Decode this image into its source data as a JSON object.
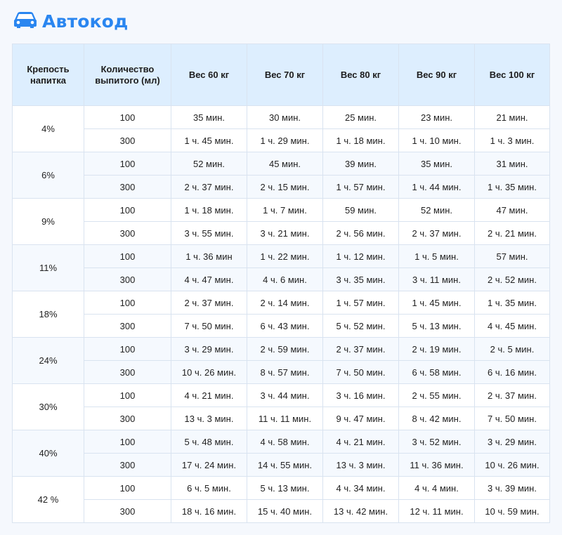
{
  "brand": {
    "name": "Автокод",
    "icon": "car-icon",
    "color": "#2a86f0"
  },
  "table": {
    "headers": [
      "Крепость напитка",
      "Количество выпитого (мл)",
      "Вес 60 кг",
      "Вес 70 кг",
      "Вес 80 кг",
      "Вес 90 кг",
      "Вес 100 кг"
    ],
    "groups": [
      {
        "strength": "4%",
        "rows": [
          {
            "amount": "100",
            "values": [
              "35 мин.",
              "30 мин.",
              "25 мин.",
              "23 мин.",
              "21 мин."
            ]
          },
          {
            "amount": "300",
            "values": [
              "1 ч. 45 мин.",
              "1 ч. 29 мин.",
              "1 ч. 18 мин.",
              "1 ч. 10 мин.",
              "1 ч. 3 мин."
            ]
          }
        ]
      },
      {
        "strength": "6%",
        "rows": [
          {
            "amount": "100",
            "values": [
              "52 мин.",
              "45 мин.",
              "39 мин.",
              "35 мин.",
              "31 мин."
            ]
          },
          {
            "amount": "300",
            "values": [
              "2 ч. 37 мин.",
              "2 ч. 15 мин.",
              "1 ч. 57 мин.",
              "1 ч. 44 мин.",
              "1 ч. 35 мин."
            ]
          }
        ]
      },
      {
        "strength": "9%",
        "rows": [
          {
            "amount": "100",
            "values": [
              "1 ч. 18 мин.",
              "1 ч. 7 мин.",
              "59 мин.",
              "52 мин.",
              "47 мин."
            ]
          },
          {
            "amount": "300",
            "values": [
              "3 ч. 55 мин.",
              "3 ч. 21 мин.",
              "2 ч. 56 мин.",
              "2 ч. 37 мин.",
              "2 ч. 21 мин."
            ]
          }
        ]
      },
      {
        "strength": "11%",
        "rows": [
          {
            "amount": "100",
            "values": [
              "1 ч. 36 мин",
              "1 ч. 22 мин.",
              "1 ч. 12 мин.",
              "1 ч. 5 мин.",
              "57 мин."
            ]
          },
          {
            "amount": "300",
            "values": [
              "4 ч. 47 мин.",
              "4 ч. 6 мин.",
              "3 ч. 35 мин.",
              "3 ч. 11 мин.",
              "2 ч. 52 мин."
            ]
          }
        ]
      },
      {
        "strength": "18%",
        "rows": [
          {
            "amount": "100",
            "values": [
              "2 ч. 37 мин.",
              "2 ч. 14 мин.",
              "1 ч. 57 мин.",
              "1 ч. 45 мин.",
              "1 ч. 35 мин."
            ]
          },
          {
            "amount": "300",
            "values": [
              "7 ч. 50 мин.",
              "6 ч. 43 мин.",
              "5 ч. 52 мин.",
              "5 ч. 13 мин.",
              "4 ч. 45 мин."
            ]
          }
        ]
      },
      {
        "strength": "24%",
        "rows": [
          {
            "amount": "100",
            "values": [
              "3 ч. 29 мин.",
              "2 ч. 59 мин.",
              "2 ч. 37 мин.",
              "2 ч. 19 мин.",
              "2 ч. 5 мин."
            ]
          },
          {
            "amount": "300",
            "values": [
              "10 ч. 26 мин.",
              "8 ч. 57 мин.",
              "7 ч. 50 мин.",
              "6 ч. 58 мин.",
              "6 ч. 16 мин."
            ]
          }
        ]
      },
      {
        "strength": "30%",
        "rows": [
          {
            "amount": "100",
            "values": [
              "4 ч. 21 мин.",
              "3 ч. 44 мин.",
              "3 ч. 16 мин.",
              "2 ч. 55 мин.",
              "2 ч. 37 мин."
            ]
          },
          {
            "amount": "300",
            "values": [
              "13 ч. 3 мин.",
              "11 ч. 11 мин.",
              "9 ч. 47 мин.",
              "8 ч. 42 мин.",
              "7 ч. 50 мин."
            ]
          }
        ]
      },
      {
        "strength": "40%",
        "rows": [
          {
            "amount": "100",
            "values": [
              "5 ч. 48 мин.",
              "4 ч. 58 мин.",
              "4 ч. 21 мин.",
              "3 ч. 52 мин.",
              "3 ч. 29 мин."
            ]
          },
          {
            "amount": "300",
            "values": [
              "17 ч. 24 мин.",
              "14 ч. 55 мин.",
              "13 ч. 3 мин.",
              "11 ч. 36 мин.",
              "10 ч. 26 мин."
            ]
          }
        ]
      },
      {
        "strength": "42 %",
        "rows": [
          {
            "amount": "100",
            "values": [
              "6 ч. 5 мин.",
              "5 ч. 13 мин.",
              "4 ч. 34 мин.",
              "4 ч. 4 мин.",
              "3 ч. 39 мин."
            ]
          },
          {
            "amount": "300",
            "values": [
              "18 ч. 16 мин.",
              "15 ч. 40 мин.",
              "13 ч. 42 мин.",
              "12 ч. 11 мин.",
              "10 ч. 59 мин."
            ]
          }
        ]
      }
    ]
  }
}
